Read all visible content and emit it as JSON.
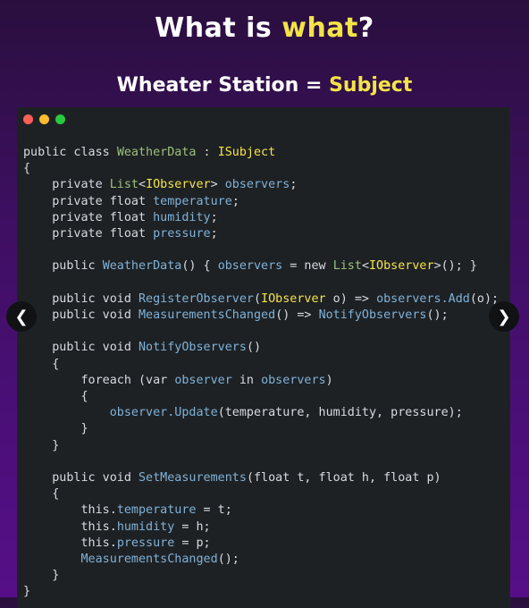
{
  "header": {
    "title_prefix": "What is ",
    "title_highlight": "what",
    "title_suffix": "?",
    "subtitle_prefix": "Wheater Station = ",
    "subtitle_highlight": "Subject"
  },
  "colors": {
    "accent": "#f3e447",
    "background_top": "#2a0f3e",
    "background_bottom": "#560f88",
    "editor_bg": "#1e2124",
    "traffic_red": "#fe5f57",
    "traffic_yellow": "#febc2e",
    "traffic_green": "#28c840"
  },
  "nav": {
    "prev_icon": "❮",
    "next_icon": "❯"
  },
  "code": {
    "l1_a": "public class ",
    "l1_b": "WeatherData",
    "l1_c": " : ",
    "l1_d": "ISubject",
    "l2": "{",
    "l3_a": "    private ",
    "l3_b": "List",
    "l3_c": "<",
    "l3_d": "IObserver",
    "l3_e": ">",
    "l3_f": " observers",
    "l3_g": ";",
    "l4_a": "    private float ",
    "l4_b": "temperature",
    "l4_c": ";",
    "l5_a": "    private float ",
    "l5_b": "humidity",
    "l5_c": ";",
    "l6_a": "    private float ",
    "l6_b": "pressure",
    "l6_c": ";",
    "l7": "",
    "l8_a": "    public ",
    "l8_b": "WeatherData",
    "l8_c": "() { ",
    "l8_d": "observers",
    "l8_e": " = new ",
    "l8_f": "List",
    "l8_g": "<",
    "l8_h": "IObserver",
    "l8_i": ">(); }",
    "l9": "",
    "l10_a": "    public void ",
    "l10_b": "RegisterObserver",
    "l10_c": "(",
    "l10_d": "IObserver",
    "l10_e": " o) => ",
    "l10_f": "observers.Add",
    "l10_g": "(o);",
    "l11_a": "    public void ",
    "l11_b": "MeasurementsChanged",
    "l11_c": "() => ",
    "l11_d": "NotifyObservers",
    "l11_e": "();",
    "l12": "",
    "l13_a": "    public void ",
    "l13_b": "NotifyObservers",
    "l13_c": "()",
    "l14": "    {",
    "l15_a": "        foreach (var ",
    "l15_b": "observer",
    "l15_c": " in ",
    "l15_d": "observers",
    "l15_e": ")",
    "l16": "        {",
    "l17_a": "            ",
    "l17_b": "observer.Update",
    "l17_c": "(temperature, humidity, pressure);",
    "l18": "        }",
    "l19": "    }",
    "l20": "",
    "l21_a": "    public void ",
    "l21_b": "SetMeasurements",
    "l21_c": "(float t, float h, float p)",
    "l22": "    {",
    "l23_a": "        this.",
    "l23_b": "temperature",
    "l23_c": " = t;",
    "l24_a": "        this.",
    "l24_b": "humidity",
    "l24_c": " = h;",
    "l25_a": "        this.",
    "l25_b": "pressure",
    "l25_c": " = p;",
    "l26_a": "        ",
    "l26_b": "MeasurementsChanged",
    "l26_c": "();",
    "l27": "    }",
    "l28": "}"
  }
}
